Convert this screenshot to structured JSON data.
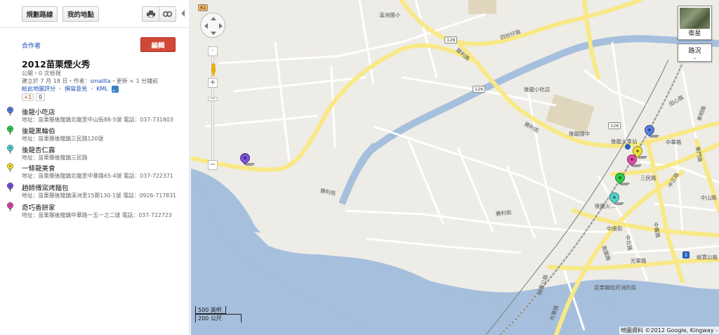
{
  "toolbar": {
    "directions": "規劃路線",
    "my_maps": "我的地點",
    "print_icon": "printer-icon",
    "link_icon": "link-icon"
  },
  "panel": {
    "collaborators": "合作者",
    "edit": "編輯",
    "title": "2012苗栗煙火秀",
    "meta_public": "公開・0 次檢視",
    "meta_created_prefix": "建立於 7 月 18 日・作者：",
    "meta_author": "smallta",
    "meta_updated": "・更新 < 1 分鐘前",
    "rate_link": "給此地圖評分",
    "comment_link": "撰寫意見",
    "kml_link": "KML",
    "gplus_label": "+1",
    "gplus_count": "0",
    "places": [
      {
        "name": "後龍小吃店",
        "addr": "地址：苗栗縣後龍鎮北龍里中山街88-5號 電話：037-731803",
        "color": "#5b7fe0"
      },
      {
        "name": "後龍黑輪伯",
        "addr": "地址：苗栗縣後龍鎮三民路120號",
        "color": "#2fcf4a"
      },
      {
        "name": "後龍杏仁露",
        "addr": "地址：苗栗縣後龍鎮三民路",
        "color": "#4fd6d0"
      },
      {
        "name": "一條龍美食",
        "addr": "地址：苗栗縣後龍鎮北龍里中華路65-4號 電話：037-722371",
        "color": "#f2e23a"
      },
      {
        "name": "趙師傅窯烤麵包",
        "addr": "地址：苗栗縣後龍鎮溪洲里15鄰130-1號 電話：0926-717831",
        "color": "#7d52d8"
      },
      {
        "name": "奇巧香餅家",
        "addr": "地址：苗栗縣後龍鎮中華路一五一之二號 電話：037-722723",
        "color": "#e04aa8"
      }
    ]
  },
  "map": {
    "satellite": "衛星",
    "traffic": "路況",
    "scale_miles": "500 英呎",
    "scale_km": "200 公尺",
    "attribution": "地圖資料 ©2012 Google, Kingway -",
    "zoom_in": "+",
    "zoom_out": "−",
    "labels": {
      "sixty_one": "61",
      "xizhou_school": "溪洲國小",
      "r126_a": "126",
      "siwei_rd": "四份仔路",
      "shengli_a": "勝利路",
      "r126_b": "126",
      "houlong_snack": "後龍小吃店",
      "shengli_b": "勝利街",
      "houlong_jh": "後龍國中",
      "r126_c": "126",
      "tianxin_rd": "田心路",
      "dongming_rd": "東明路",
      "houlong_station": "後龍火車站",
      "zhonghua_rd": "中華路",
      "dongmen_rd": "東門路",
      "sanmin_rd": "三民路",
      "zhongshan_rd": "中山路",
      "zhongzheng_rd": "中正路",
      "shengli_c": "勝利街",
      "shengli_d": "勝利街",
      "zhongnan_st": "中南街",
      "nanyuan_rd": "南園路",
      "zhongbei_rd": "中北路",
      "zhongyi_rd": "中義路",
      "r1": "1",
      "zongguan_rd": "縱貫公路",
      "guanghua_rd": "光華路",
      "fire_station": "苗栗縣政府消防局",
      "zongguan_rd2": "縱貫公路",
      "guanghua_rd2": "光華路",
      "houlong_dots": "後龍火…"
    }
  }
}
